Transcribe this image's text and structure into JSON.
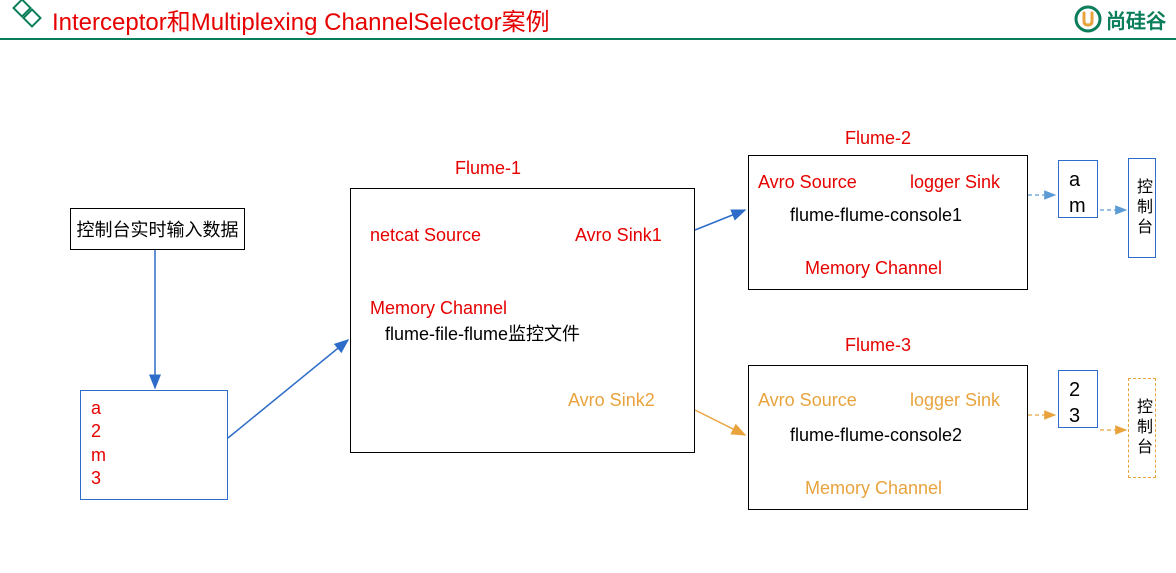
{
  "header": {
    "title": "Interceptor和Multiplexing ChannelSelector案例",
    "brand": "尚硅谷"
  },
  "nodes": {
    "input_title": "控制台实时输入数据",
    "input_data": [
      "a",
      "2",
      "m",
      "3"
    ],
    "flume1": {
      "title": "Flume-1",
      "source": "netcat Source",
      "channel": "Memory  Channel",
      "desc": "flume-file-flume监控文件",
      "sink1": "Avro Sink1",
      "sink2": "Avro Sink2"
    },
    "flume2": {
      "title": "Flume-2",
      "source": "Avro Source",
      "sink": "logger Sink",
      "desc": "flume-flume-console1",
      "channel": "Memory Channel"
    },
    "flume3": {
      "title": "Flume-3",
      "source": "Avro Source",
      "sink": "logger Sink",
      "desc": "flume-flume-console2",
      "channel": "Memory Channel"
    },
    "out1": [
      "a",
      "m"
    ],
    "out2": [
      "2",
      "3"
    ],
    "console_label": "控制台"
  }
}
